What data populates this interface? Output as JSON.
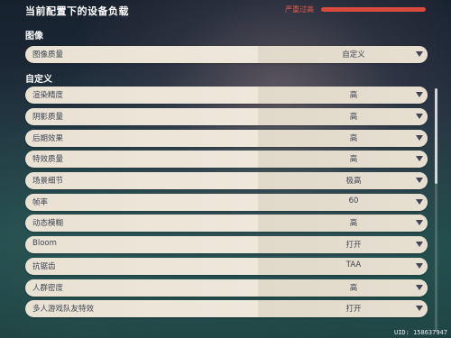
{
  "header": {
    "title": "当前配置下的设备负载",
    "load_label": "严重过高",
    "load_color": "#d94a3c"
  },
  "sections": {
    "image": {
      "label": "图像",
      "rows": [
        {
          "label": "图像质量",
          "value": "自定义"
        }
      ]
    },
    "custom": {
      "label": "自定义",
      "rows": [
        {
          "label": "渲染精度",
          "value": "高"
        },
        {
          "label": "阴影质量",
          "value": "高"
        },
        {
          "label": "后期效果",
          "value": "高"
        },
        {
          "label": "特效质量",
          "value": "高"
        },
        {
          "label": "场景细节",
          "value": "极高"
        },
        {
          "label": "帧率",
          "value": "60"
        },
        {
          "label": "动态模糊",
          "value": "高"
        },
        {
          "label": "Bloom",
          "value": "打开"
        },
        {
          "label": "抗锯齿",
          "value": "TAA"
        },
        {
          "label": "人群密度",
          "value": "高"
        },
        {
          "label": "多人游戏队友特效",
          "value": "打开"
        }
      ]
    }
  },
  "uid": "UID: 158637947",
  "colors": {
    "row_bg": "#e9e2d3",
    "text_dark": "#3e4452",
    "warning": "#e85a4a"
  }
}
